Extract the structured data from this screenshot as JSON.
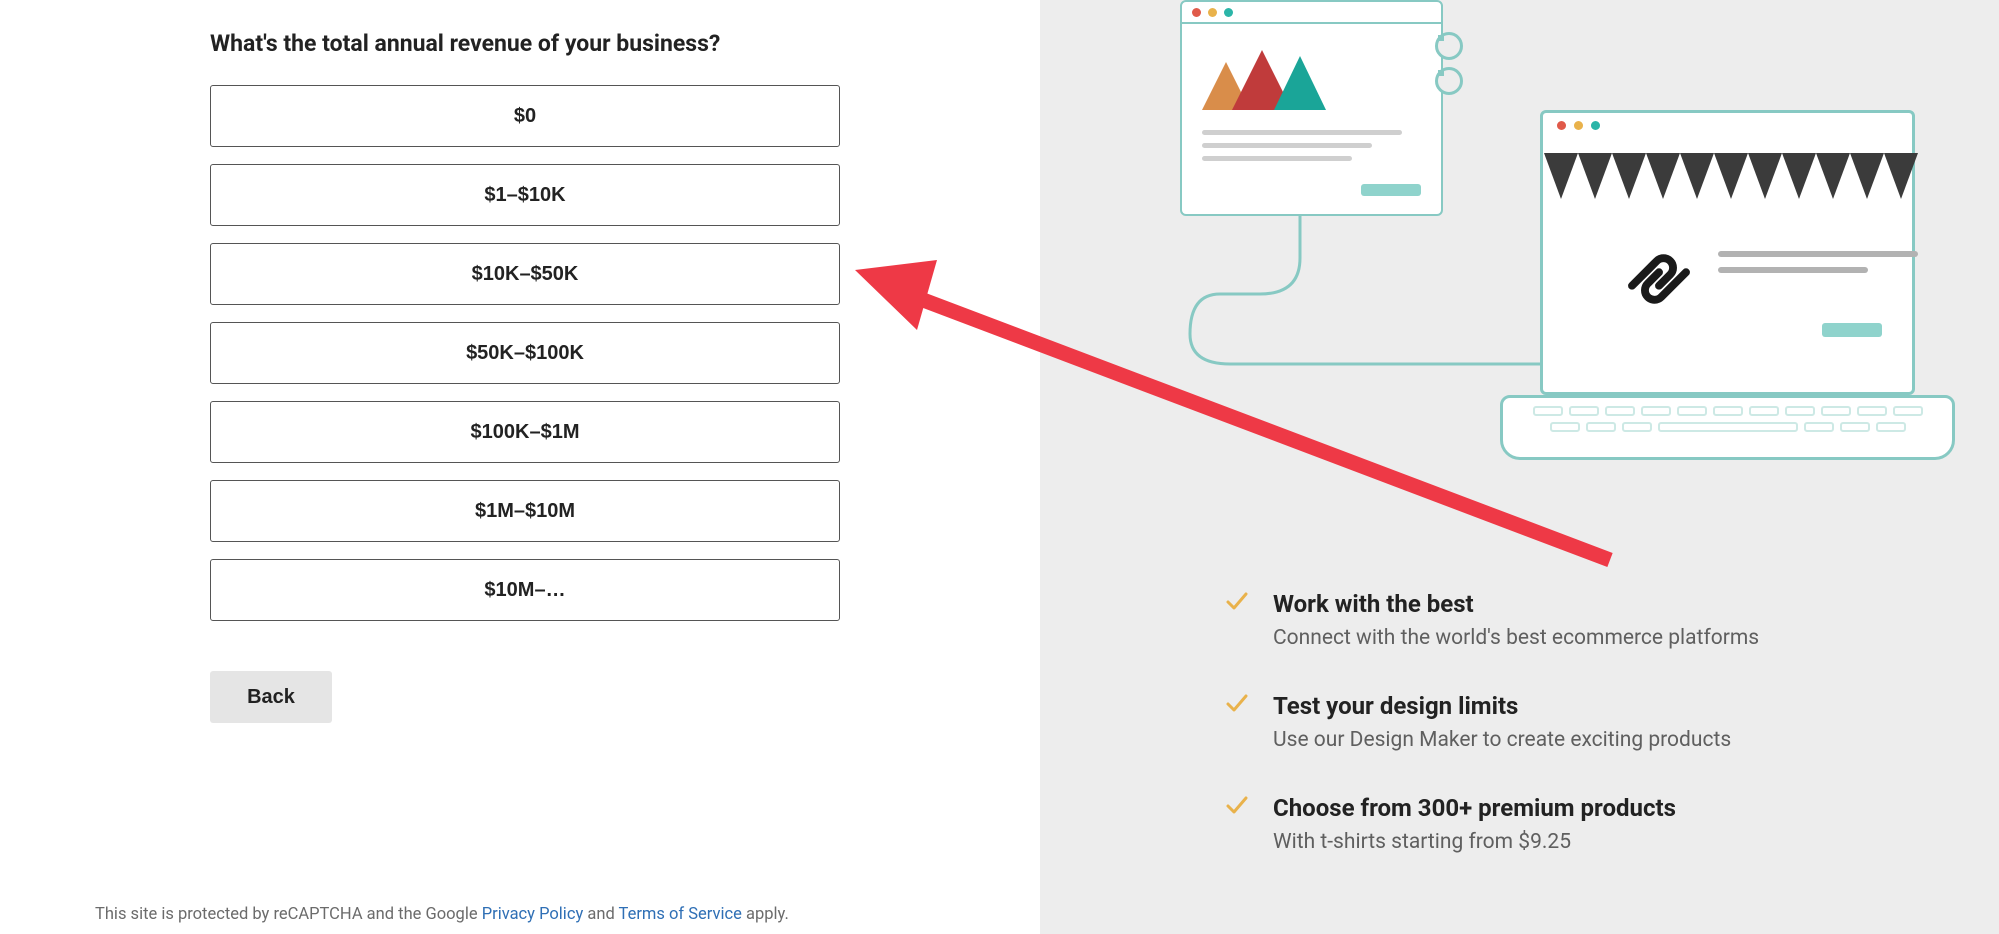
{
  "form": {
    "heading": "What's the total annual revenue of your business?",
    "options": [
      "$0",
      "$1–$10K",
      "$10K–$50K",
      "$50K–$100K",
      "$100K–$1M",
      "$1M–$10M",
      "$10M–…"
    ],
    "back_label": "Back"
  },
  "footer": {
    "prefix": "This site is protected by reCAPTCHA and the Google ",
    "privacy": "Privacy Policy",
    "middle": " and ",
    "tos": "Terms of Service",
    "suffix": " apply."
  },
  "features": [
    {
      "title": "Work with the best",
      "desc": "Connect with the world's best ecommerce platforms"
    },
    {
      "title": "Test your design limits",
      "desc": "Use our Design Maker to create exciting products"
    },
    {
      "title": "Choose from 300+ premium products",
      "desc": "With t-shirts starting from $9.25"
    }
  ]
}
